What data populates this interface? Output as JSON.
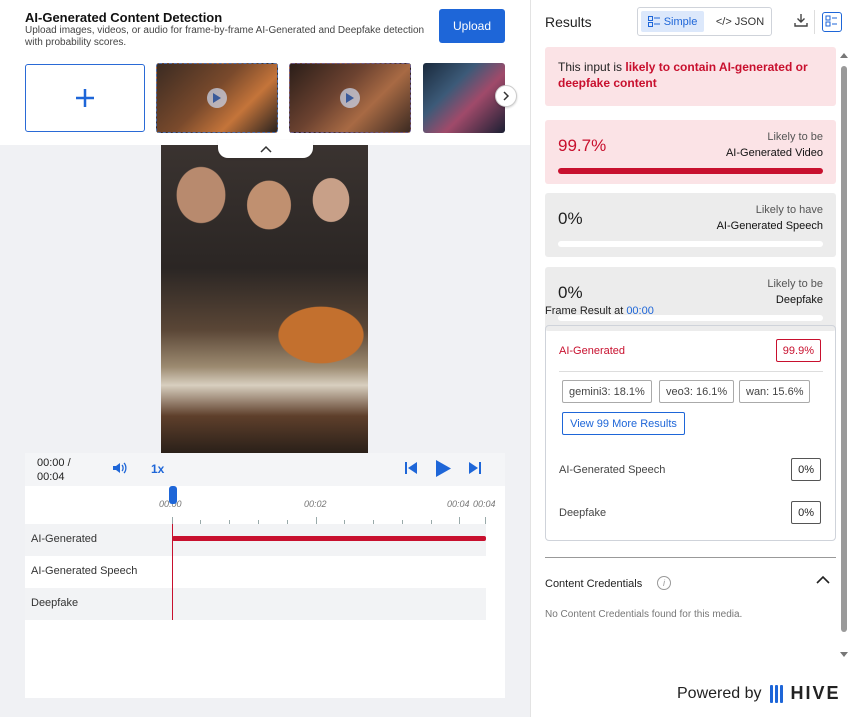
{
  "header": {
    "title": "AI-Generated Content Detection",
    "subtitle": "Upload images, videos, or audio for frame-by-frame AI-Generated and Deepfake detection with probability scores.",
    "upload_label": "Upload"
  },
  "player": {
    "time_current": "00:00 /",
    "time_total": "00:04",
    "speed": "1x",
    "ticks": [
      "00:00",
      "00:02",
      "00:04",
      "00:04"
    ],
    "tracks": [
      "AI-Generated",
      "AI-Generated Speech",
      "Deepfake"
    ]
  },
  "results": {
    "title": "Results",
    "view_simple": "Simple",
    "view_json": "</> JSON",
    "banner_prefix": "This input is ",
    "banner_highlight": "likely to contain AI-generated or deepfake content",
    "cards": [
      {
        "pct": "99.7%",
        "label1": "Likely to be",
        "label2": "AI-Generated Video",
        "fill": 1.0
      },
      {
        "pct": "0%",
        "label1": "Likely to have",
        "label2": "AI-Generated Speech",
        "fill": 0
      },
      {
        "pct": "0%",
        "label1": "Likely to be",
        "label2": "Deepfake",
        "fill": 0
      }
    ],
    "frame_title": "Frame Result at ",
    "frame_time": "00:00",
    "frame_ai_label": "AI-Generated",
    "frame_ai_value": "99.9%",
    "chips": [
      "gemini3: 18.1%",
      "veo3: 16.1%",
      "wan: 15.6%"
    ],
    "more_label": "View 99 More Results",
    "speech_label": "AI-Generated Speech",
    "speech_value": "0%",
    "deepfake_label": "Deepfake",
    "deepfake_value": "0%",
    "cc_title": "Content Credentials",
    "cc_text": "No Content Credentials found for this media.",
    "powered_by": "Powered by",
    "brand": "HIVE"
  },
  "colors": {
    "accent": "#1e66d8",
    "danger": "#c8102e",
    "danger_bg": "#fbe3e6"
  }
}
